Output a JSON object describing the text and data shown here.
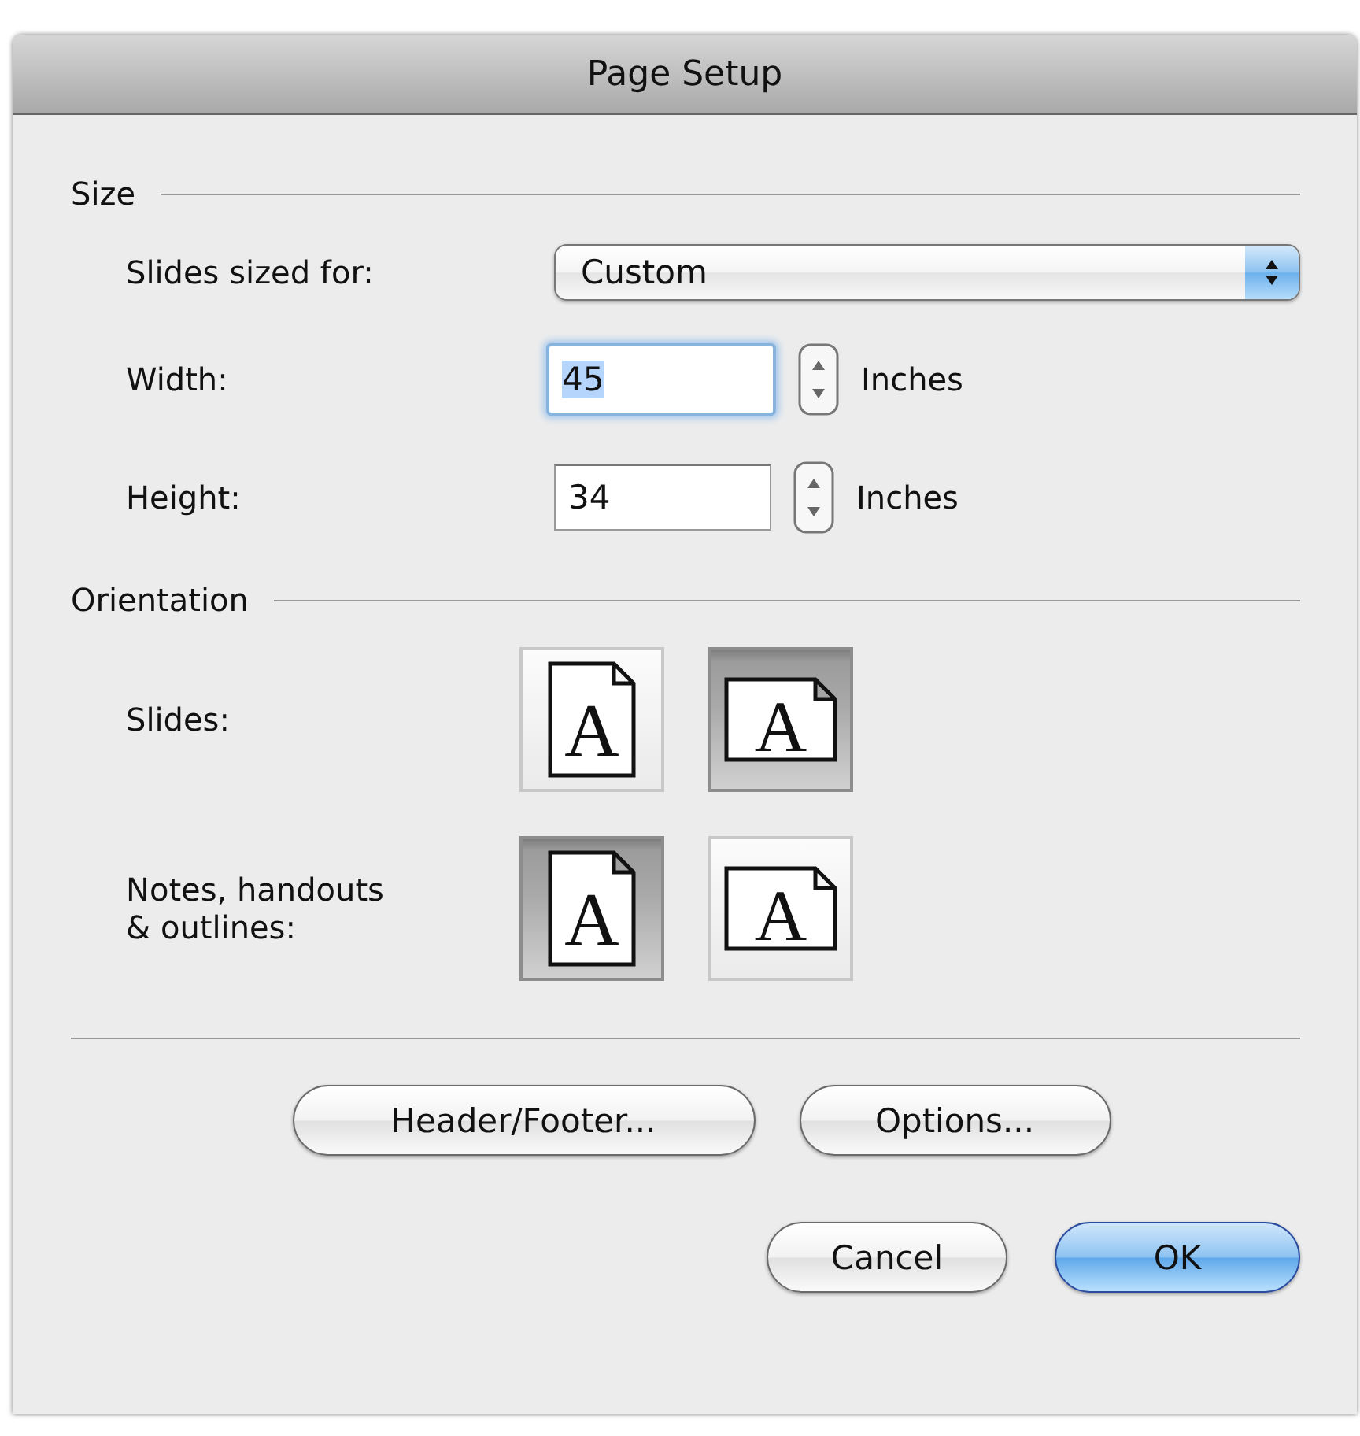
{
  "window": {
    "title": "Page Setup"
  },
  "size": {
    "heading": "Size",
    "slides_sized_for": {
      "label": "Slides sized for:",
      "value": "Custom"
    },
    "fields": [
      {
        "label": "Width:",
        "value": "45",
        "unit": "Inches",
        "focused": true
      },
      {
        "label": "Height:",
        "value": "34",
        "unit": "Inches",
        "focused": false
      }
    ]
  },
  "orientation": {
    "heading": "Orientation",
    "rows": [
      {
        "label": "Slides:",
        "options": [
          {
            "kind": "portrait",
            "glyph": "A",
            "selected": false
          },
          {
            "kind": "landscape",
            "glyph": "A",
            "selected": true
          }
        ]
      },
      {
        "label": "Notes, handouts\n& outlines:",
        "options": [
          {
            "kind": "portrait",
            "glyph": "A",
            "selected": true
          },
          {
            "kind": "landscape",
            "glyph": "A",
            "selected": false
          }
        ]
      }
    ]
  },
  "buttons": [
    {
      "label": "Header/Footer..."
    },
    {
      "label": "Options..."
    }
  ],
  "dialog_buttons": [
    {
      "label": "Cancel",
      "default": false
    },
    {
      "label": "OK",
      "default": true
    }
  ]
}
